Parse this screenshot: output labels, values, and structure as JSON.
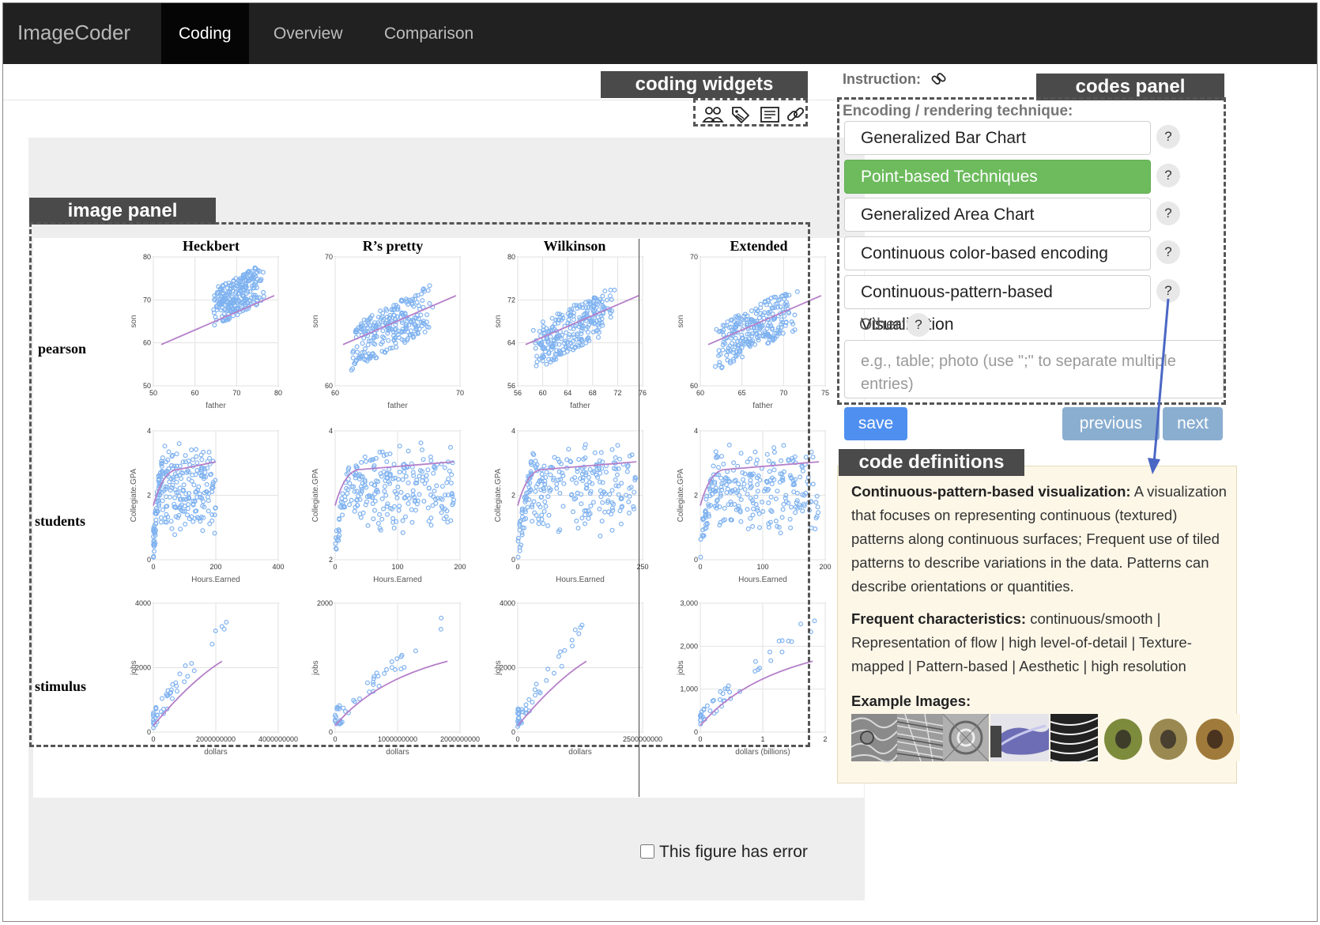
{
  "navbar": {
    "brand": "ImageCoder",
    "tabs": [
      {
        "label": "Coding",
        "active": true
      },
      {
        "label": "Overview",
        "active": false
      },
      {
        "label": "Comparison",
        "active": false
      }
    ]
  },
  "annotations": {
    "coding_widgets": "coding widgets",
    "image_panel": "image panel",
    "codes_panel": "codes panel",
    "code_definitions": "code definitions"
  },
  "widgets": {
    "icons": [
      "users-icon",
      "tags-icon",
      "notes-icon",
      "link-icon"
    ]
  },
  "image_panel": {
    "columns": [
      "Heckbert",
      "R’s pretty",
      "Wilkinson",
      "Extended"
    ],
    "rows": [
      "pearson",
      "students",
      "stimulus"
    ],
    "pearson": {
      "xlabel": "father",
      "ylabel": "son",
      "ticks": [
        {
          "x": [
            "50",
            "60",
            "70",
            "80"
          ],
          "y": [
            "50",
            "60",
            "70",
            "80"
          ]
        },
        {
          "x": [
            "60",
            "70"
          ],
          "y": [
            "60",
            "70"
          ]
        },
        {
          "x": [
            "56",
            "60",
            "64",
            "68",
            "72",
            "76"
          ],
          "y": [
            "56",
            "64",
            "72",
            "80"
          ]
        },
        {
          "x": [
            "60",
            "65",
            "70",
            "75"
          ],
          "y": [
            "60",
            "70"
          ]
        }
      ]
    },
    "students": {
      "xlabel": "Hours.Earned",
      "ylabel": "Collegiate.GPA",
      "ticks": [
        {
          "x": [
            "0",
            "200",
            "400"
          ],
          "y": [
            "0",
            "2",
            "4"
          ]
        },
        {
          "x": [
            "0",
            "100",
            "200"
          ],
          "y": [
            "2",
            "4"
          ]
        },
        {
          "x": [
            "0",
            "250"
          ],
          "y": [
            "0",
            "2",
            "4"
          ]
        },
        {
          "x": [
            "0",
            "100",
            "200"
          ],
          "y": [
            "0",
            "2",
            "4"
          ]
        }
      ]
    },
    "stimulus": {
      "xlabels": [
        "dollars",
        "dollars",
        "dollars",
        "dollars (billions)"
      ],
      "ylabel": "jobs",
      "ticks": [
        {
          "x": [
            "0",
            "2000000000",
            "4000000000"
          ],
          "y": [
            "0",
            "2000",
            "4000"
          ]
        },
        {
          "x": [
            "0",
            "1000000000",
            "2000000000"
          ],
          "y": [
            "0",
            "2000"
          ]
        },
        {
          "x": [
            "0",
            "2500000000"
          ],
          "y": [
            "0",
            "2000",
            "4000"
          ]
        },
        {
          "x": [
            "0",
            "1",
            "2"
          ],
          "y": [
            "0",
            "1,000",
            "2,000",
            "3,000"
          ]
        }
      ]
    },
    "error_checkbox_label": "This figure has error"
  },
  "codes_panel": {
    "instruction_label": "Instruction:",
    "section_title": "Encoding / rendering technique:",
    "codes": [
      {
        "label": "Generalized Bar Chart",
        "selected": false
      },
      {
        "label": "Point-based Techniques",
        "selected": true
      },
      {
        "label": "Generalized Area Chart",
        "selected": false
      },
      {
        "label": "Continuous color-based encoding",
        "selected": false
      },
      {
        "label": "Continuous-pattern-based Visualization",
        "selected": false
      }
    ],
    "help_label": "?",
    "other_label": "Other:",
    "other_placeholder": "e.g., table; photo (use \";\" to separate multiple entries)",
    "buttons": {
      "save": "save",
      "previous": "previous",
      "next": "next"
    }
  },
  "code_definition": {
    "term": "Continuous-pattern-based visualization:",
    "definition": "A visualization that focuses on representing continuous (textured) patterns along continuous surfaces; Frequent use of tiled patterns to describe variations in the data. Patterns can describe orientations or quantities.",
    "characteristics_label": "Frequent characteristics:",
    "characteristics": "continuous/smooth | Representation of flow | high level-of-detail | Texture-mapped | Pattern-based | Aesthetic | high resolution",
    "examples_label": "Example Images:"
  },
  "colors": {
    "navbar": "#212121",
    "selected_code": "#6dbb5d",
    "save": "#4f8ff0",
    "nav_buttons": "#8aaed0",
    "scatter_point": "#7fb2f0",
    "trend_line": "#b57fc9",
    "arrow": "#4a67c4"
  }
}
